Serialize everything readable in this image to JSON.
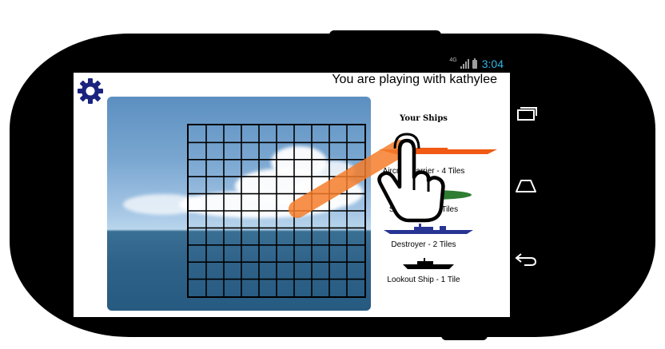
{
  "status_bar": {
    "network": "4G",
    "time": "3:04"
  },
  "header": {
    "title": "You are playing with kathylee"
  },
  "board": {
    "rows": 10,
    "cols": 10
  },
  "ships_panel": {
    "title": "Your Ships",
    "ships": [
      {
        "label": "Aircraft Carrier - 4 Tiles",
        "color": "#f05a14",
        "icon": "aircraft-carrier-icon"
      },
      {
        "label": "Submarine - 3 Tiles",
        "color": "#2e7d32",
        "icon": "submarine-icon"
      },
      {
        "label": "Destroyer - 2 Tiles",
        "color": "#283593",
        "icon": "destroyer-icon"
      },
      {
        "label": "Lookout Ship - 1 Tile",
        "color": "#000000",
        "icon": "lookout-ship-icon"
      }
    ]
  },
  "colors": {
    "accent": "#33b5e5",
    "settings_icon": "#1a237e",
    "swipe": "#f57c2a"
  },
  "nav_buttons": [
    "recent-apps-icon",
    "home-icon",
    "back-icon"
  ]
}
